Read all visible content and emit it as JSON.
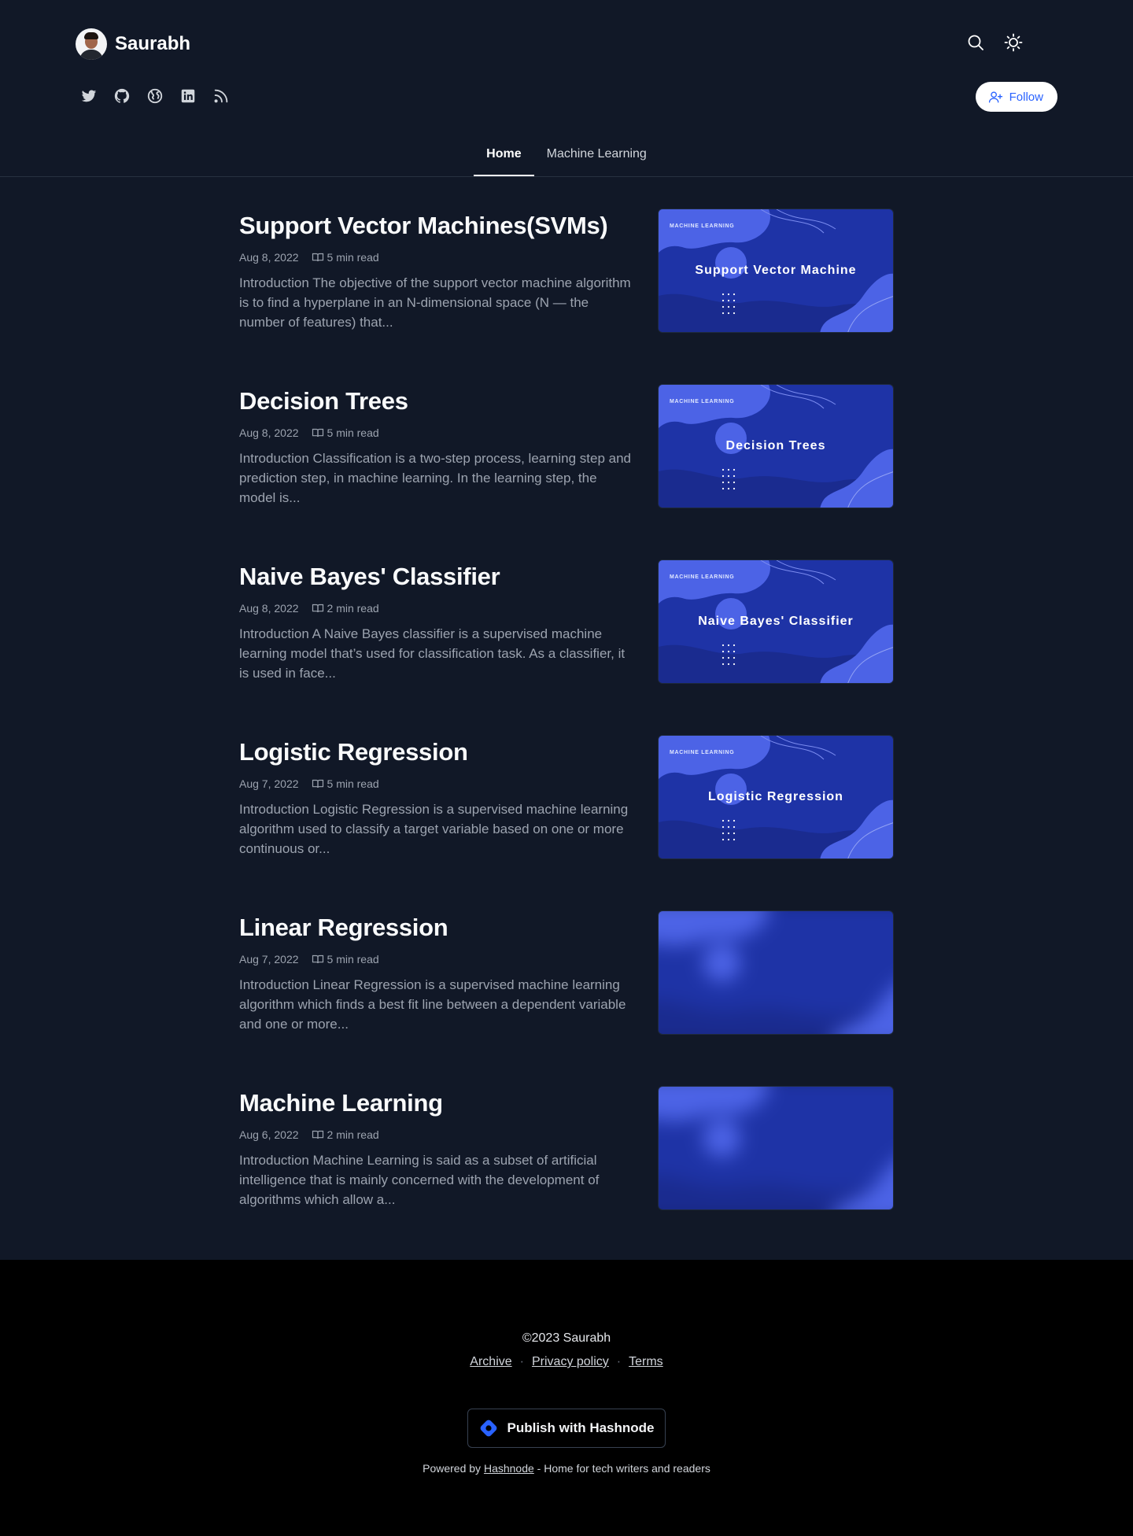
{
  "blog": {
    "name": "Saurabh",
    "follow_label": "Follow"
  },
  "header_icons": [
    "search-icon",
    "sun-icon"
  ],
  "socials": [
    "twitter-icon",
    "github-icon",
    "globe-icon",
    "linkedin-icon",
    "rss-icon"
  ],
  "tabs": [
    {
      "label": "Home",
      "active": true
    },
    {
      "label": "Machine Learning",
      "active": false
    }
  ],
  "posts": [
    {
      "title": "Support Vector Machines(SVMs)",
      "date": "Aug 8, 2022",
      "read_time": "5 min read",
      "excerpt": "Introduction The objective of the support vector machine algorithm is to find a hyperplane in an N-dimensional space (N — the number of features) that...",
      "cover_kicker": "MACHINE LEARNING",
      "cover_title": "Support Vector Machine"
    },
    {
      "title": "Decision Trees",
      "date": "Aug 8, 2022",
      "read_time": "5 min read",
      "excerpt": "Introduction Classification is a two-step process, learning step and prediction step, in machine learning. In the learning step, the model is...",
      "cover_kicker": "MACHINE LEARNING",
      "cover_title": "Decision Trees"
    },
    {
      "title": "Naive Bayes' Classifier",
      "date": "Aug 8, 2022",
      "read_time": "2 min read",
      "excerpt": "Introduction A Naive Bayes classifier is a supervised machine learning model that’s used for classification task. As a classifier, it is used in face...",
      "cover_kicker": "MACHINE LEARNING",
      "cover_title": "Naive Bayes' Classifier"
    },
    {
      "title": "Logistic Regression",
      "date": "Aug 7, 2022",
      "read_time": "5 min read",
      "excerpt": "Introduction Logistic Regression is a supervised machine learning algorithm used to classify a target variable based on one or more continuous or...",
      "cover_kicker": "MACHINE LEARNING",
      "cover_title": "Logistic Regression"
    },
    {
      "title": "Linear Regression",
      "date": "Aug 7, 2022",
      "read_time": "5 min read",
      "excerpt": "Introduction Linear Regression is a supervised machine learning algorithm which finds a best fit line between a dependent variable and one or more...",
      "cover_blurred": true
    },
    {
      "title": "Machine Learning",
      "date": "Aug 6, 2022",
      "read_time": "2 min read",
      "excerpt": "Introduction Machine Learning is said as a subset of artificial intelligence that is mainly concerned with the development of algorithms which allow a...",
      "cover_blurred": true
    }
  ],
  "footer": {
    "copyright": "©2023 Saurabh",
    "links": [
      "Archive",
      "Privacy policy",
      "Terms"
    ],
    "publish_label": "Publish with Hashnode",
    "powered_prefix": "Powered by",
    "powered_link": "Hashnode",
    "powered_suffix": "- Home for tech writers and readers"
  },
  "colors": {
    "background": "#111827",
    "footer_background": "#000000",
    "accent": "#2962ff",
    "cover_dark": "#1e33a6",
    "cover_light": "#4c63e6"
  }
}
